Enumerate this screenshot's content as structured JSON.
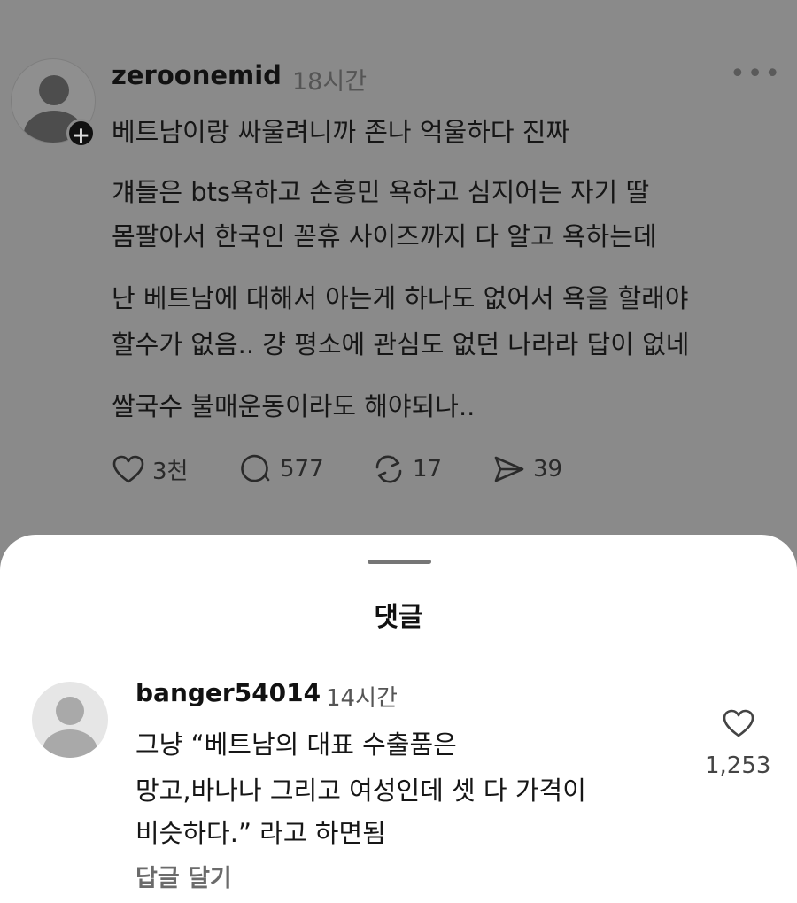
{
  "post": {
    "username": "zeroonemid",
    "time": "18시간",
    "more_icon": "more-icon",
    "follow_icon": "plus-icon",
    "lines": [
      "베트남이랑 싸울려니까 존나 억울하다 진짜",
      "걔들은 bts욕하고 손흥민 욕하고 심지어는 자기 딸",
      "몸팔아서 한국인 꼳휴 사이즈까지 다 알고 욕하는데",
      "난 베트남에 대해서 아는게 하나도 없어서 욕을 할래야",
      "할수가 없음.. 걍 평소에 관심도 없던 나라라 답이 없네",
      "쌀국수 불매운동이라도 해야되나.."
    ],
    "actions": {
      "likes": "3천",
      "comments": "577",
      "reposts": "17",
      "shares": "39"
    }
  },
  "sheet": {
    "title": "댓글",
    "comment": {
      "username": "banger54014",
      "time": "14시간",
      "lines": [
        "그냥 “베트남의 대표 수출품은",
        "망고,바나나 그리고 여성인데 셋 다 가격이",
        "비슷하다.” 라고 하면됨"
      ],
      "like_count": "1,253",
      "reply_label": "답글 달기"
    }
  },
  "colors": {
    "dimmed_background": "#8a8a8a",
    "sheet_background": "#ffffff"
  }
}
